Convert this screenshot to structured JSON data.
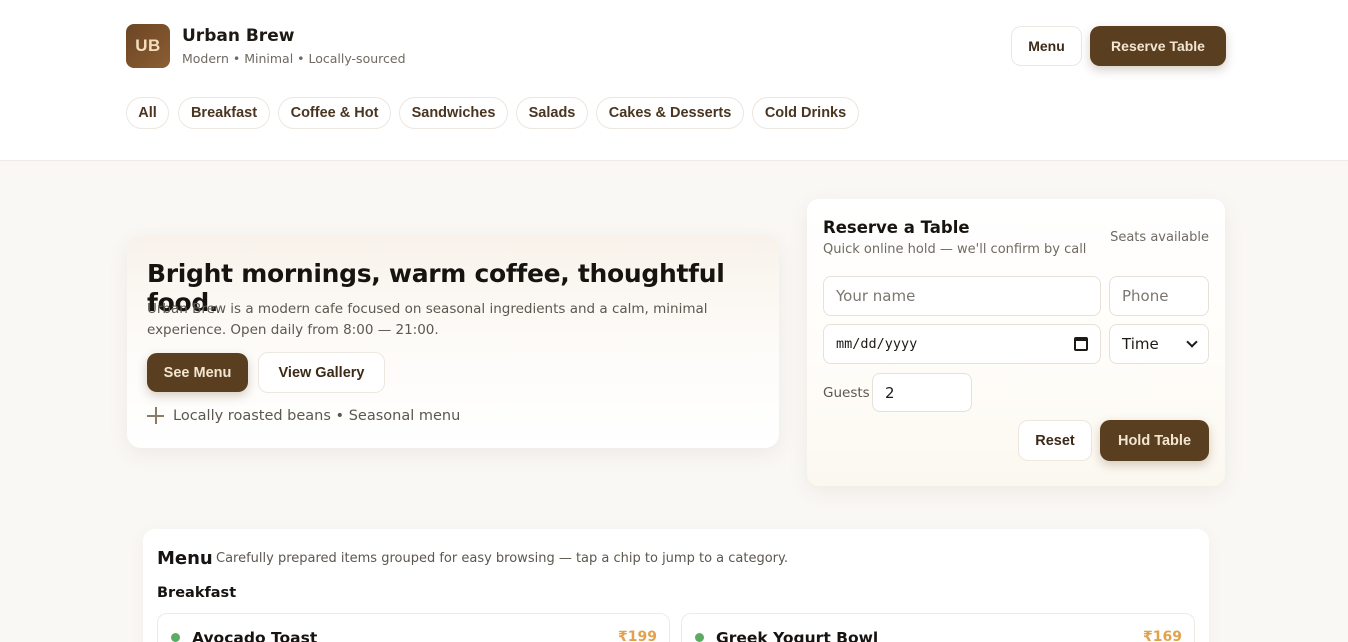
{
  "brand": {
    "logo_text": "UB",
    "name": "Urban Brew",
    "tagline": "Modern • Minimal • Locally-sourced"
  },
  "header": {
    "menu_label": "Menu",
    "reserve_label": "Reserve Table"
  },
  "chips": [
    "All",
    "Breakfast",
    "Coffee & Hot",
    "Sandwiches",
    "Salads",
    "Cakes & Desserts",
    "Cold Drinks"
  ],
  "hero": {
    "title": "Bright mornings, warm coffee, thoughtful food.",
    "description": "Urban Brew is a modern cafe focused on seasonal ingredients and a calm, minimal experience. Open daily from 8:00 — 21:00.",
    "see_menu_label": "See Menu",
    "view_gallery_label": "View Gallery",
    "note": "Locally roasted beans • Seasonal menu"
  },
  "reservation": {
    "title": "Reserve a Table",
    "subtitle": "Quick online hold — we'll confirm by call",
    "seats": "Seats available",
    "name_placeholder": "Your name",
    "phone_placeholder": "Phone",
    "date_placeholder": "mm/dd/yyyy",
    "time_selected": "Time",
    "guests_label": "Guests",
    "guests_value": "2",
    "reset_label": "Reset",
    "hold_label": "Hold Table"
  },
  "menu": {
    "title": "Menu",
    "description": "Carefully prepared items grouped for easy browsing — tap a chip to jump to a category.",
    "category": "Breakfast",
    "items": [
      {
        "name": "Avocado Toast",
        "price": "₹199"
      },
      {
        "name": "Greek Yogurt Bowl",
        "price": "₹169"
      }
    ]
  },
  "colors": {
    "primary": "#5a3e20",
    "accent_price": "#e2a24c",
    "veg_dot": "#5bab62",
    "background": "#faf8f5"
  }
}
